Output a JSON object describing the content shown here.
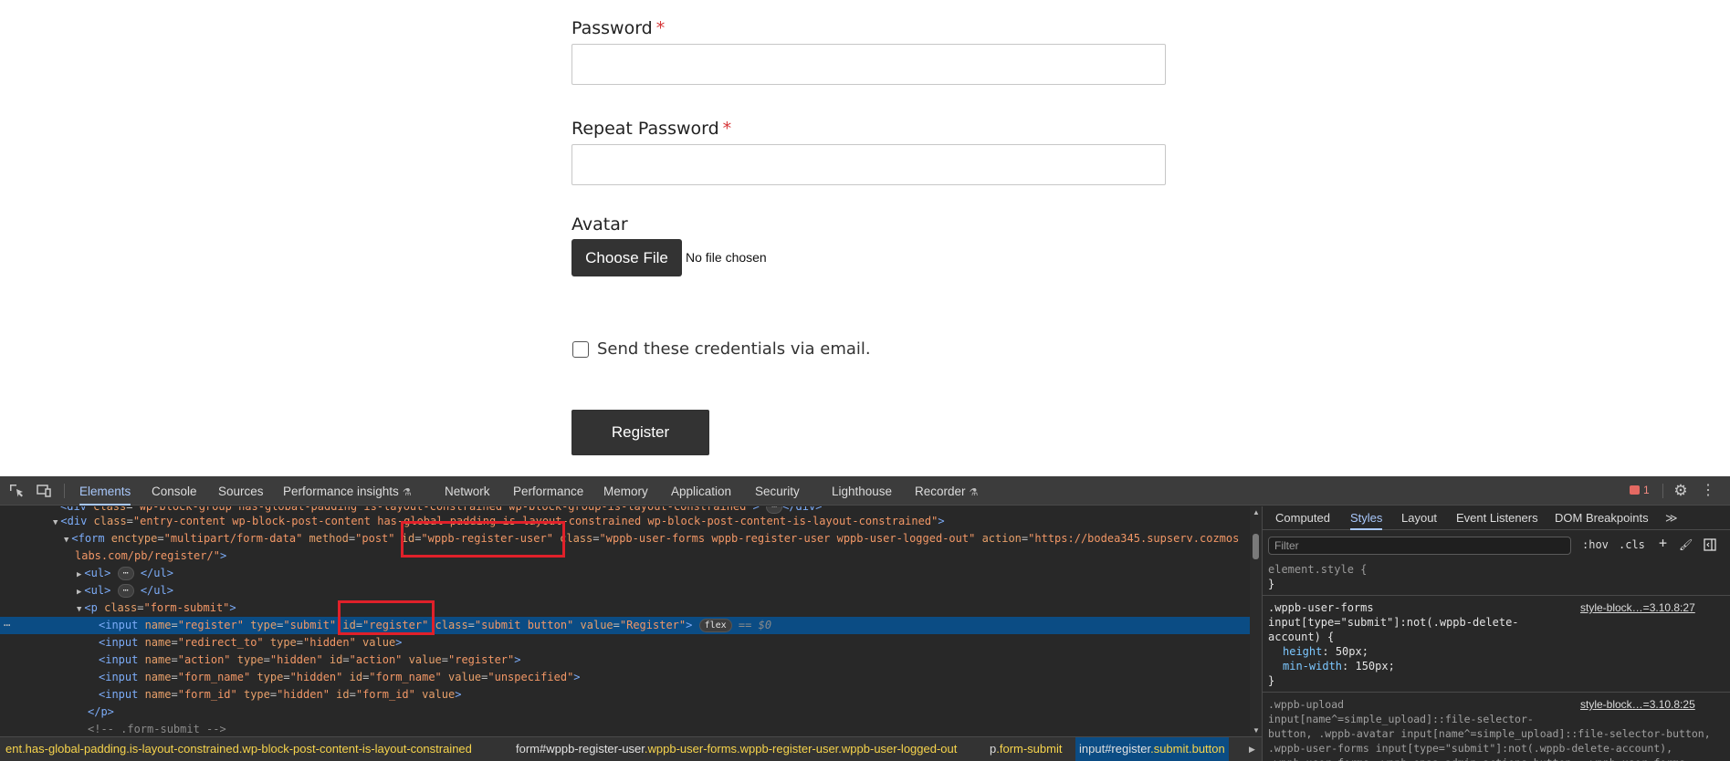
{
  "form": {
    "password_label": "Password",
    "repeat_password_label": "Repeat Password",
    "required_mark": "*",
    "avatar_label": "Avatar",
    "choose_file_label": "Choose File",
    "file_status": "No file chosen",
    "send_credentials_label": "Send these credentials via email.",
    "register_button": "Register"
  },
  "devtools": {
    "tabs": [
      "Elements",
      "Console",
      "Sources",
      "Performance insights",
      "Network",
      "Performance",
      "Memory",
      "Application",
      "Security",
      "Lighthouse",
      "Recorder"
    ],
    "issues_count": "1",
    "style_tabs": [
      "Computed",
      "Styles",
      "Layout",
      "Event Listeners",
      "DOM Breakpoints"
    ],
    "filter_placeholder": "Filter",
    "hov": ":hov",
    "cls": ".cls",
    "breadcrumbs": [
      {
        "tag": "",
        "id": "",
        "cls": "ent.has-global-padding.is-layout-constrained.wp-block-post-content-is-layout-constrained"
      },
      {
        "tag": "form",
        "id": "#wppb-register-user",
        "cls": ".wppb-user-forms.wppb-register-user.wppb-user-logged-out"
      },
      {
        "tag": "p",
        "id": "",
        "cls": ".form-submit"
      },
      {
        "tag": "input",
        "id": "#register",
        "cls": ".submit.button"
      }
    ],
    "styles": {
      "element_style": "element.style {",
      "element_style_close": "}",
      "rule1_selector": ".wppb-user-forms\ninput[type=\"submit\"]:not(.wppb-delete-\naccount) {",
      "rule1_src": "style-block…=3.10.8:27",
      "rule1_p1": "height",
      "rule1_v1": "50px;",
      "rule1_p2": "min-width",
      "rule1_v2": "150px;",
      "rule1_close": "}",
      "rule2_selector": ".wppb-upload\ninput[name^=simple_upload]::file-selector-\nbutton, .wppb-avatar input[name^=simple_upload]::file-selector-button,\n.wppb-user-forms input[type=\"submit\"]:not(.wppb-delete-account),\n.wppb-user-forms .wppb-epaa-admin-actions button, .wppb-user-forms",
      "rule2_src": "style-block…=3.10.8:25"
    }
  }
}
